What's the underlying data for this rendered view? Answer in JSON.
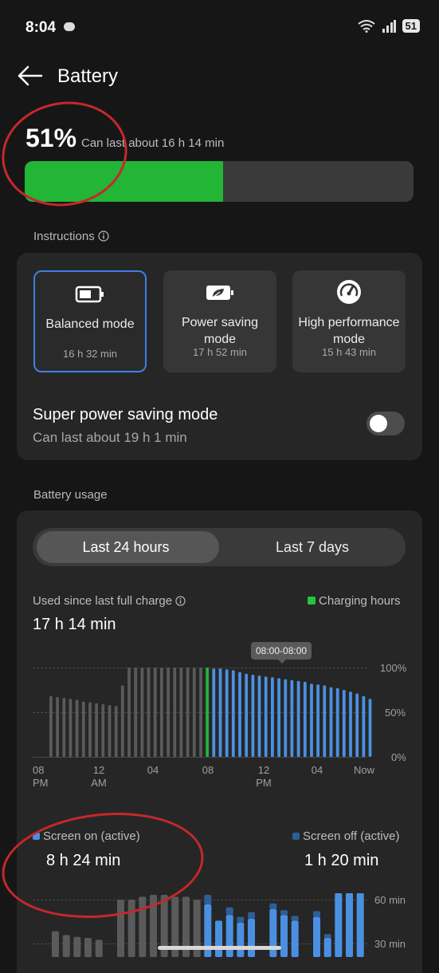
{
  "status_bar": {
    "time": "8:04",
    "battery": "51"
  },
  "header": {
    "title": "Battery"
  },
  "summary": {
    "percent": "51%",
    "estimate": "Can last about 16 h 14 min",
    "level": 0.51
  },
  "instructions": {
    "label": "Instructions"
  },
  "modes": [
    {
      "name_line1": "Balanced mode",
      "name_line2": "",
      "time": "16 h 32 min",
      "icon": "battery-icon",
      "selected": true
    },
    {
      "name_line1": "Power saving",
      "name_line2": "mode",
      "time": "17 h 52 min",
      "icon": "leaf-battery-icon",
      "selected": false
    },
    {
      "name_line1": "High performance",
      "name_line2": "mode",
      "time": "15 h 43 min",
      "icon": "speedometer-icon",
      "selected": false
    }
  ],
  "super_saving": {
    "title": "Super power saving mode",
    "subtitle": "Can last about 19 h 1 min",
    "enabled": false
  },
  "usage": {
    "section_label": "Battery usage",
    "tabs": {
      "left": "Last 24 hours",
      "right": "Last 7 days",
      "selected": "left"
    },
    "used_label": "Used since last full charge",
    "used_value": "17 h 14 min",
    "legend_charging": "Charging hours",
    "tooltip": "08:00-08:00",
    "screen_on_label": "Screen on (active)",
    "screen_on_value": "8 h 24 min",
    "screen_off_label": "Screen off (active)",
    "screen_off_value": "1 h 20 min"
  },
  "colors": {
    "green": "#22b536",
    "blue": "#4a90e2",
    "blue_dark": "#2d5f97",
    "gray_bar": "#5a5a5a",
    "accent_border": "#3d7fe6"
  },
  "chart_data": [
    {
      "type": "bar",
      "title": "",
      "y_ticks": [
        "100%",
        "50%",
        "0%"
      ],
      "x_ticks": [
        {
          "line1": "08",
          "line2": "PM"
        },
        {
          "line1": "12",
          "line2": "AM"
        },
        {
          "line1": "04",
          "line2": ""
        },
        {
          "line1": "08",
          "line2": ""
        },
        {
          "line1": "12",
          "line2": "PM"
        },
        {
          "line1": "04",
          "line2": ""
        },
        {
          "line1": "Now",
          "line2": ""
        }
      ],
      "ylim": [
        0,
        100
      ],
      "values": [
        68,
        67,
        66,
        65,
        64,
        62,
        61,
        60,
        59,
        58,
        57,
        80,
        100,
        100,
        100,
        100,
        100,
        100,
        100,
        100,
        100,
        100,
        100,
        100,
        100,
        99,
        99,
        98,
        97,
        95,
        93,
        92,
        91,
        90,
        89,
        88,
        87,
        86,
        85,
        84,
        82,
        81,
        80,
        78,
        77,
        75,
        73,
        71,
        68,
        65,
        60,
        57
      ],
      "segments": [
        "gray",
        "gray",
        "gray",
        "gray",
        "gray",
        "gray",
        "gray",
        "gray",
        "gray",
        "gray",
        "gray",
        "gray",
        "gray",
        "gray",
        "gray",
        "gray",
        "gray",
        "gray",
        "gray",
        "gray",
        "gray",
        "gray",
        "gray",
        "gray",
        "green",
        "blue",
        "blue",
        "blue",
        "blue",
        "blue",
        "blue",
        "blue",
        "blue",
        "blue",
        "blue",
        "blue",
        "blue",
        "blue",
        "blue",
        "blue",
        "blue",
        "blue",
        "blue",
        "blue",
        "blue",
        "blue",
        "blue",
        "blue",
        "blue",
        "blue",
        "blue",
        "blue"
      ]
    },
    {
      "type": "bar",
      "title": "",
      "y_ticks": [
        "60 min",
        "30 min"
      ],
      "ylim": [
        0,
        60
      ],
      "series": [
        {
          "name": "Screen on (active)",
          "values": [
            27,
            23,
            21,
            20,
            18,
            0,
            60,
            60,
            63,
            65,
            65,
            63,
            63,
            60,
            55,
            38,
            44,
            36,
            40,
            0,
            50,
            44,
            38,
            0,
            42,
            20,
            67,
            67,
            67,
            0,
            0
          ]
        },
        {
          "name": "Screen off (active)",
          "values": [
            0,
            0,
            0,
            0,
            0,
            0,
            0,
            0,
            0,
            0,
            0,
            0,
            0,
            0,
            10,
            0,
            8,
            6,
            7,
            0,
            6,
            5,
            5,
            0,
            6,
            4,
            0,
            0,
            0,
            0,
            0
          ]
        }
      ]
    }
  ]
}
